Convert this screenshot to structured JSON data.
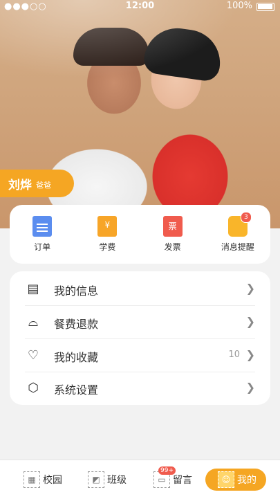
{
  "status_bar": {
    "signal": "●●●○○",
    "time": "12:00",
    "battery": "100%"
  },
  "profile": {
    "name": "刘烨",
    "role": "爸爸"
  },
  "quick_actions": [
    {
      "label": "订单",
      "icon": "order-icon"
    },
    {
      "label": "学费",
      "icon": "tuition-icon",
      "glyph": "¥"
    },
    {
      "label": "发票",
      "icon": "invoice-icon",
      "glyph": "票"
    },
    {
      "label": "消息提醒",
      "icon": "bell-icon",
      "badge": "3"
    }
  ],
  "menu": [
    {
      "label": "我的信息",
      "icon": "id-card-icon"
    },
    {
      "label": "餐费退款",
      "icon": "meal-icon"
    },
    {
      "label": "我的收藏",
      "icon": "heart-icon",
      "count": "10"
    },
    {
      "label": "系统设置",
      "icon": "settings-icon"
    }
  ],
  "tabs": [
    {
      "label": "校园",
      "icon": "campus-icon"
    },
    {
      "label": "班级",
      "icon": "class-icon"
    },
    {
      "label": "留言",
      "icon": "message-icon",
      "badge": "99+"
    },
    {
      "label": "我的",
      "icon": "me-icon",
      "active": true
    }
  ],
  "colors": {
    "accent": "#f5a623",
    "badge": "#f05b4d",
    "background": "#f2f2f2"
  }
}
